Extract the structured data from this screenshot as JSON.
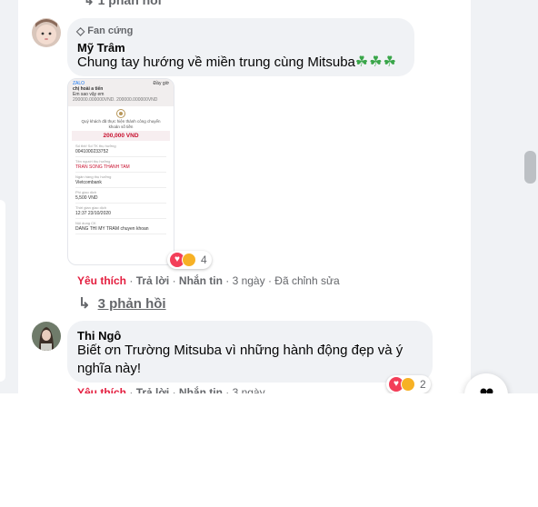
{
  "prev_reply": {
    "label": "1 phản hồi"
  },
  "comment1": {
    "badge": "Fan cứng",
    "author": "Mỹ Trâm",
    "text": "Chung tay hướng về miền trung cùng Mitsuba",
    "emoji": "☘☘☘",
    "reaction_count": "4",
    "actions": {
      "like": "Yêu thích",
      "reply": "Trả lời",
      "share": "Nhắn tin",
      "time": "3 ngày",
      "edited": "Đã chỉnh sửa"
    },
    "replies_label": "3 phản hồi",
    "receipt": {
      "app": "ZALO",
      "status_right": "Đầy giờ",
      "chat_title": "chị hoài a tiến",
      "chat_sub": "Em sao vậy em",
      "truncated_line": "200000.000000VND. 200000.000000VND",
      "success_text": "Quý khách đã thực hiện thành công chuyển khoản số tiền",
      "amount": "200,000 VND",
      "fields": [
        {
          "label": "Số thẻ/ Số TK thụ hưởng",
          "value": "0041000233752"
        },
        {
          "label": "Tên người thụ hưởng",
          "value": "TRAN SONG THANH TAM",
          "red": true
        },
        {
          "label": "Ngân hàng thụ hưởng",
          "value": "Vietcombank"
        },
        {
          "label": "Phí giao dịch",
          "value": "5,500 VND"
        },
        {
          "label": "Thời gian giao dịch",
          "value": "12:37 23/10/2020"
        },
        {
          "label": "Nội dung CK",
          "value": "DANG THI MY TRAM chuyen khoan"
        }
      ]
    }
  },
  "comment2": {
    "author": "Thi Ngô",
    "text_line1": "Biết ơn Trường Mitsuba vì những hành động đẹp và ý",
    "text_line2": "nghĩa này!",
    "reaction_count": "2",
    "actions": {
      "like": "Yêu thích",
      "reply": "Trả lời",
      "share": "Nhắn tin",
      "time": "3 ngày"
    }
  },
  "colors": {
    "like": "#e41e3f",
    "bubble": "#f0f2f5",
    "text": "#050505",
    "muted": "#65676b"
  }
}
